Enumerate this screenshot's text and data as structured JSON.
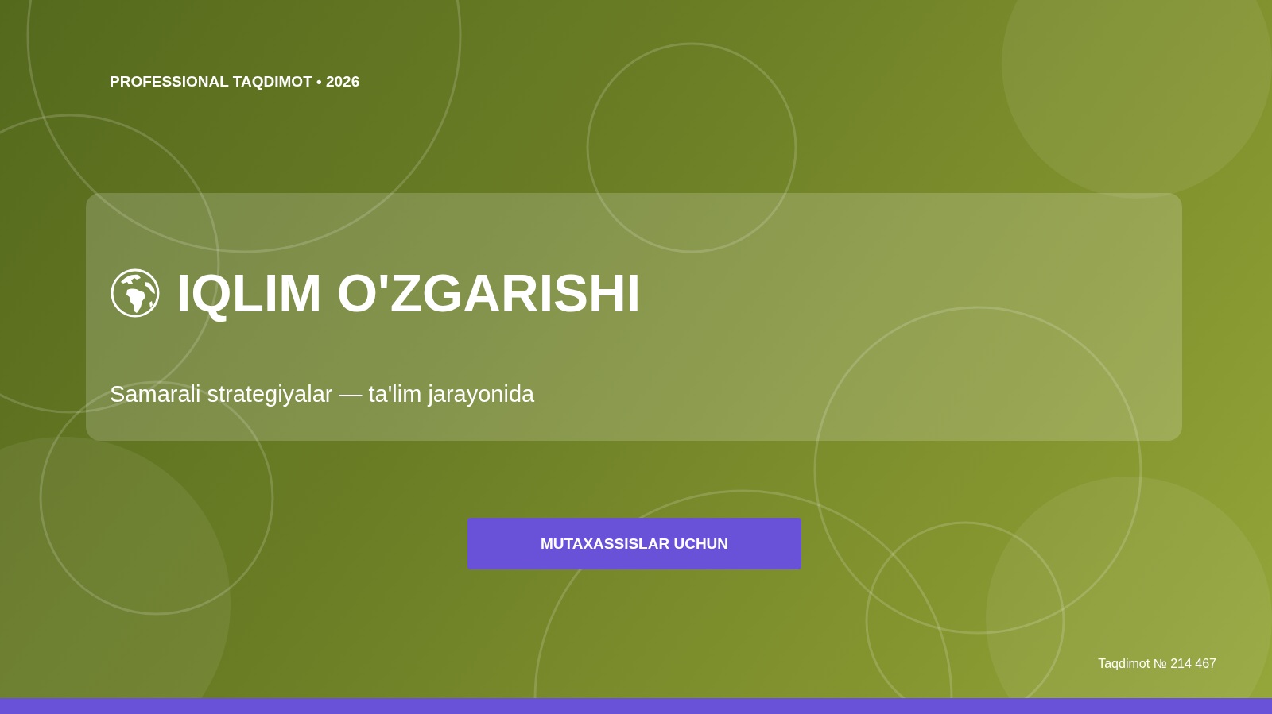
{
  "eyebrow": "PROFESSIONAL TAQDIMOT • 2026",
  "title": "IQLIM O'ZGARISHI",
  "subtitle": "Samarali strategiyalar — ta'lim jarayonida",
  "button": "MUTAXASSISLAR UCHUN",
  "footer": "Taqdimot № 214 467"
}
